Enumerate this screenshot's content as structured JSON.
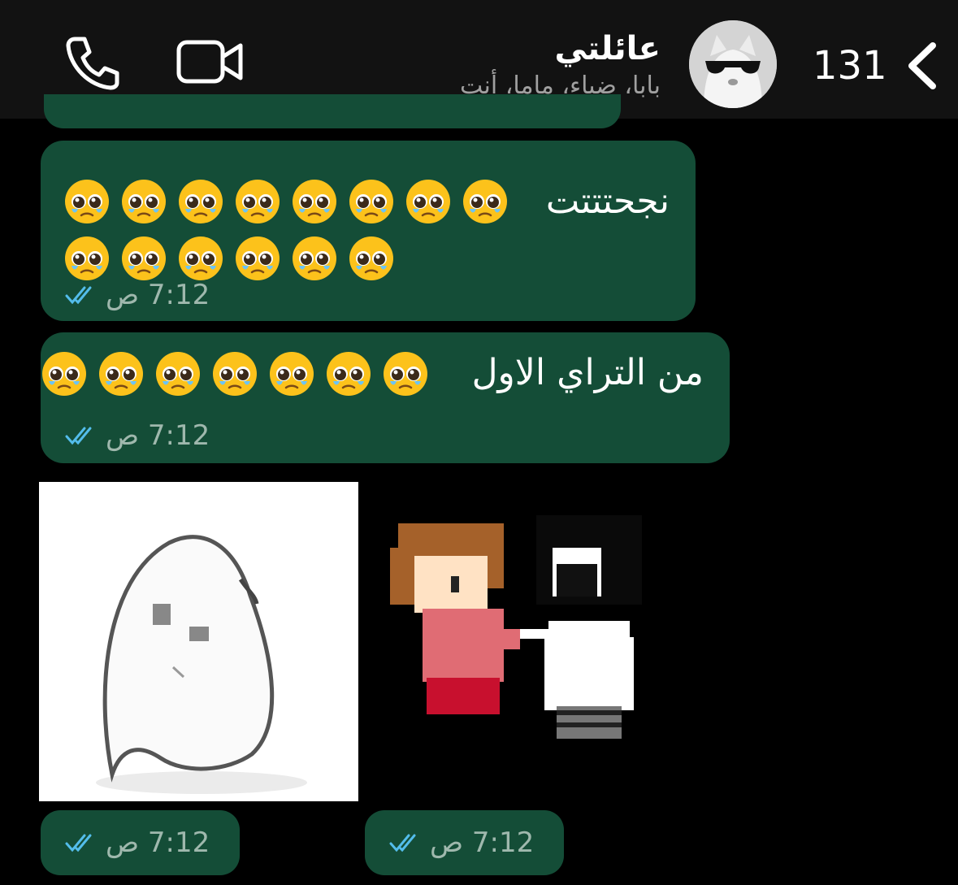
{
  "header": {
    "back_count": "131",
    "group_name": "عائلتي",
    "members": "بابا، ضياء، ماما، أنت",
    "icons": {
      "back": "chevron-left-icon",
      "call": "phone-icon",
      "video": "video-camera-icon",
      "avatar": "group-avatar-cat-sunglasses"
    }
  },
  "messages": [
    {
      "text": "نجحتتتت",
      "emoji": "pleading-face",
      "emoji_line1_count": 8,
      "emoji_line2_count": 6,
      "time": "7:12 ص",
      "status": "read"
    },
    {
      "text": "من التراي الاول",
      "emoji": "pleading-face",
      "emoji_line1_count": 7,
      "time": "7:12 ص",
      "status": "read"
    }
  ],
  "stickers": [
    {
      "name": "crying-blob-sticker",
      "time": "7:12 ص",
      "status": "read"
    },
    {
      "name": "pixel-kids-sticker",
      "time": "7:12 ص",
      "status": "read"
    }
  ],
  "colors": {
    "header_bg": "#121212",
    "bubble_bg": "#144d37",
    "tick_read": "#53bdeb",
    "time_text": "#9fb8ad"
  }
}
